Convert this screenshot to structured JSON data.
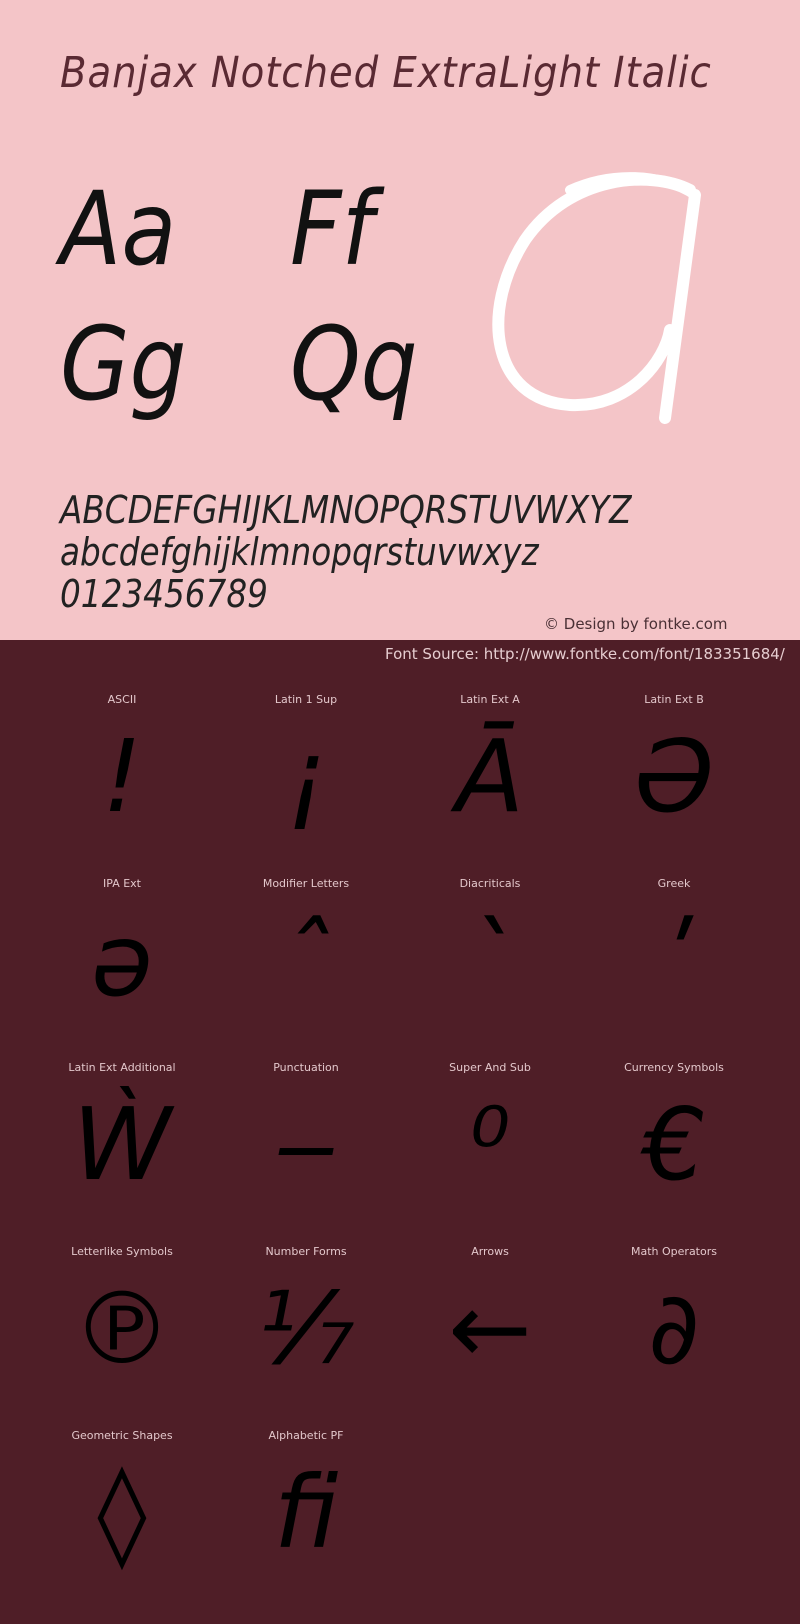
{
  "header": {
    "title": "Banjax Notched ExtraLight Italic"
  },
  "preview": {
    "pairs": [
      "Aa",
      "Ff",
      "Gg",
      "Qq"
    ],
    "big_glyph": "a",
    "uppercase": "ABCDEFGHIJKLMNOPQRSTUVWXYZ",
    "lowercase": "abcdefghijklmnopqrstuvwxyz",
    "digits": "0123456789"
  },
  "credit": "© Design by fontke.com",
  "source": "Font Source: http://www.fontke.com/font/183351684/",
  "colors": {
    "top_background": "#f4c5c8",
    "bottom_background": "#4f1e27",
    "glyph": "#000000",
    "label": "#e3c7cb"
  },
  "blocks": [
    {
      "label": "ASCII",
      "glyph": "!"
    },
    {
      "label": "Latin 1 Sup",
      "glyph": "¡"
    },
    {
      "label": "Latin Ext A",
      "glyph": "Ā"
    },
    {
      "label": "Latin Ext B",
      "glyph": "Ə"
    },
    {
      "label": "IPA Ext",
      "glyph": "ə"
    },
    {
      "label": "Modifier Letters",
      "glyph": "ˆ"
    },
    {
      "label": "Diacriticals",
      "glyph": "`"
    },
    {
      "label": "Greek",
      "glyph": "ʹ"
    },
    {
      "label": "Latin Ext Additional",
      "glyph": "Ẁ"
    },
    {
      "label": "Punctuation",
      "glyph": "‒"
    },
    {
      "label": "Super And Sub",
      "glyph": "⁰"
    },
    {
      "label": "Currency Symbols",
      "glyph": "€"
    },
    {
      "label": "Letterlike Symbols",
      "glyph": "℗"
    },
    {
      "label": "Number Forms",
      "glyph": "⅐"
    },
    {
      "label": "Arrows",
      "glyph": "←"
    },
    {
      "label": "Math Operators",
      "glyph": "∂"
    },
    {
      "label": "Geometric Shapes",
      "glyph": "◊"
    },
    {
      "label": "Alphabetic PF",
      "glyph": "ﬁ"
    }
  ]
}
